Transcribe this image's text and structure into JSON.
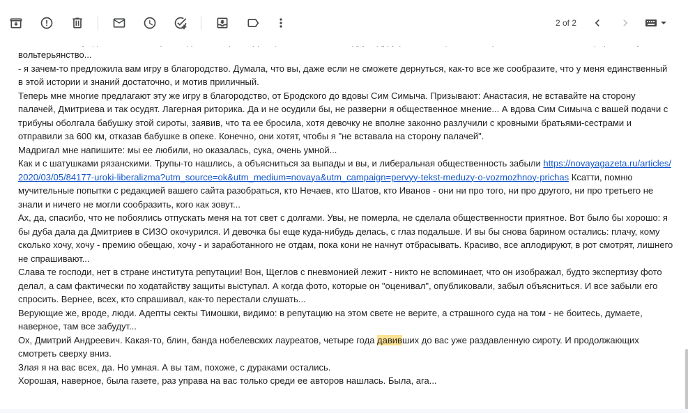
{
  "toolbar": {
    "buttons": [
      {
        "name": "archive-icon",
        "tooltip": "Archive"
      },
      {
        "name": "report-spam-icon",
        "tooltip": "Report spam"
      },
      {
        "name": "delete-icon",
        "tooltip": "Delete"
      },
      {
        "name": "mark-unread-icon",
        "tooltip": "Mark as unread"
      },
      {
        "name": "snooze-icon",
        "tooltip": "Snooze"
      },
      {
        "name": "add-task-icon",
        "tooltip": "Add to tasks"
      },
      {
        "name": "move-to-icon",
        "tooltip": "Move to"
      },
      {
        "name": "label-icon",
        "tooltip": "Labels"
      },
      {
        "name": "more-icon",
        "tooltip": "More"
      }
    ],
    "pager_text": "2 of 2",
    "prev_icon": "chevron-left-icon",
    "next_icon": "chevron-right-icon",
    "input_tools_icon": "keyboard-icon"
  },
  "message": {
    "p1": "портретов лишь потому, что вы нужны им с хорошей репутацией. И что Соловьева в телеэфир с этой темой не выпустили ни разу - он только в интернете это часами обсуждал. А телевизор был до сентября за Дмитриева. Скобеева вдруг сдуру решила еще летом пересказать мой текст в эфире - получила за вольтерьянство...",
    "p2": "- я зачем-то предложила вам игру в благородство. Думала, что вы, даже если не сможете дернуться, как-то все же сообразите, что у меня единственный в этой истории и знаний достаточно, и мотив приличный.",
    "p3": "Теперь мне многие предлагают эту же игру в благородство, от Бродского до вдовы Сим Симыча. Призывают: Анастасия, не вставайте на сторону палачей, Дмитриева и так осудят. Лагерная риторика. Да и не осудили бы, не разверни я общественное мнение... А вдова Сим Симыча с вашей подачи с трибуны оболгала бабушку этой сироты, заявив, что та ее бросила, хотя девочку не вполне законно разлучили с кровными братьями-сестрами и отправили за 600 км, отказав бабушке в опеке. Конечно, они хотят, чтобы я \"не вставала на сторону палачей\".",
    "p4": "Мадригал мне напишите: мы ее любили, но оказалась, сука, очень умной...",
    "p5_before": "Как и с шатушками рязанскими. Трупы-то нашлись, а объясниться за выпады и вы, и либеральная общественность забыли ",
    "p5_link": "https://novayagazeta.ru/articles/2020/03/05/84177-uroki-liberalizma?utm_source=ok&utm_medium=novaya&utm_campaign=pervyy-tekst-meduzy-o-vozmozhnoy-prichas",
    "p5_after": " Ксатти, помню мучительные попытки с редакцией вашего сайта разобраться, кто Нечаев, кто Шатов, кто Иванов - они ни про того, ни про другого, ни про третьего не знали и ничего не могли сообразить, кого как зовут...",
    "p6": "Ах, да, спасибо, что не побоялись отпускать меня на тот свет с долгами. Увы, не померла, не сделала общественности приятное. Вот было бы хорошо: я бы дуба дала да Дмитриев в СИЗО окочурился. И девочка бы еще куда-нибудь делась, с глаз подальше. И вы бы снова барином остались: плачу, кому сколько хочу, хочу - премию обещаю, хочу - и заработанного не отдам, пока кони не начнут отбрасывать. Красиво, все аплодируют, в рот смотрят, лишнего не спрашивают...",
    "p7": "Слава те господи, нет в стране института репутации! Вон, Щеглов с пневмонией лежит - никто не вспоминает, что он изображал, будто экспертизу фото делал, а сам фактически по ходатайству защиты выступал. А когда фото, которые он \"оценивал\", опубликовали, забыл объясниться. И все забыли его спросить. Вернее, всех, кто спрашивал, как-то перестали слушать...",
    "p8": "Верующие же, вроде, люди. Адепты секты Тимошки, видимо: в репутацию на этом свете не верите, а страшного суда на том - не боитесь, думаете, наверное, там все забудут...",
    "p9_before": "Ох, Дмитрий Андреевич. Какая-то, блин, банда нобелевских лауреатов, четыре года ",
    "p9_highlight": "давив",
    "p9_after": "ших до вас уже раздавленную сироту. И продолжающих смотреть сверху вниз.",
    "p10": "Злая я на вас всех, да. Но умная. А вы там, похоже, с дураками остались.",
    "p11": "Хорошая, наверное, была газете, раз управа на вас только среди ее авторов нашлась. Была, ага..."
  },
  "colors": {
    "text": "#222222",
    "link": "#1155cc",
    "highlight": "#fde293",
    "icon": "#444746"
  }
}
